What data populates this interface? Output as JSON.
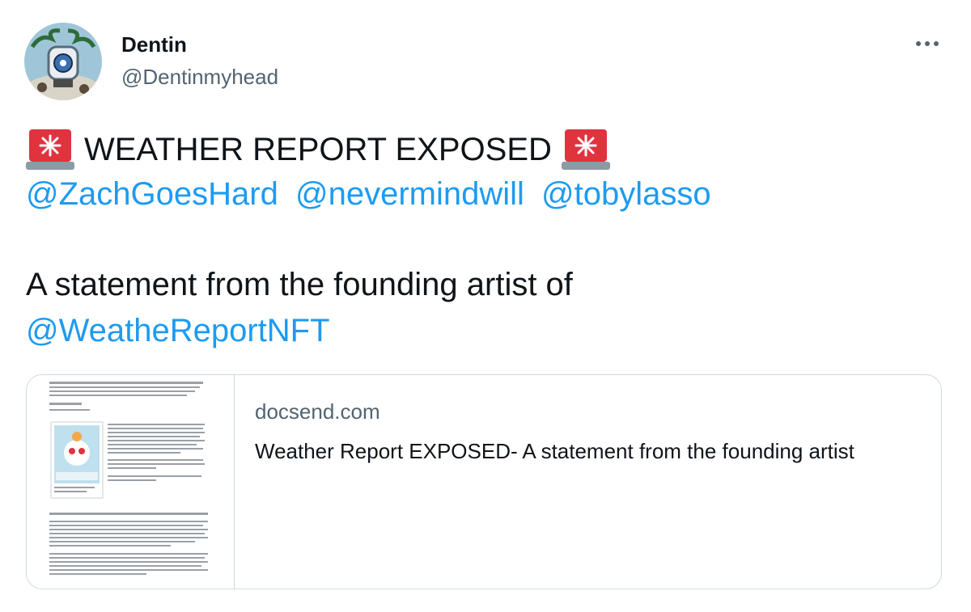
{
  "user": {
    "display_name": "Dentin",
    "handle": "@Dentinmyhead",
    "avatar_icon": "avatar-image"
  },
  "tweet": {
    "headline": "WEATHER REPORT EXPOSED",
    "headline_icon": "police-car-light-icon",
    "mentions": [
      "@ZachGoesHard",
      "@nevermindwill",
      "@tobylasso"
    ],
    "statement": "A statement from the founding artist of",
    "statement_mention": "@WeatheReportNFT"
  },
  "link_card": {
    "domain": "docsend.com",
    "title": "Weather Report EXPOSED- A statement from the founding artist",
    "thumbnail_icon": "document-preview-thumbnail"
  },
  "menu": {
    "icon": "more-horizontal-icon"
  },
  "colors": {
    "link": "#1d9bf0",
    "secondary_text": "#536471",
    "border": "#cfd9de",
    "siren_red": "#e0333e"
  }
}
